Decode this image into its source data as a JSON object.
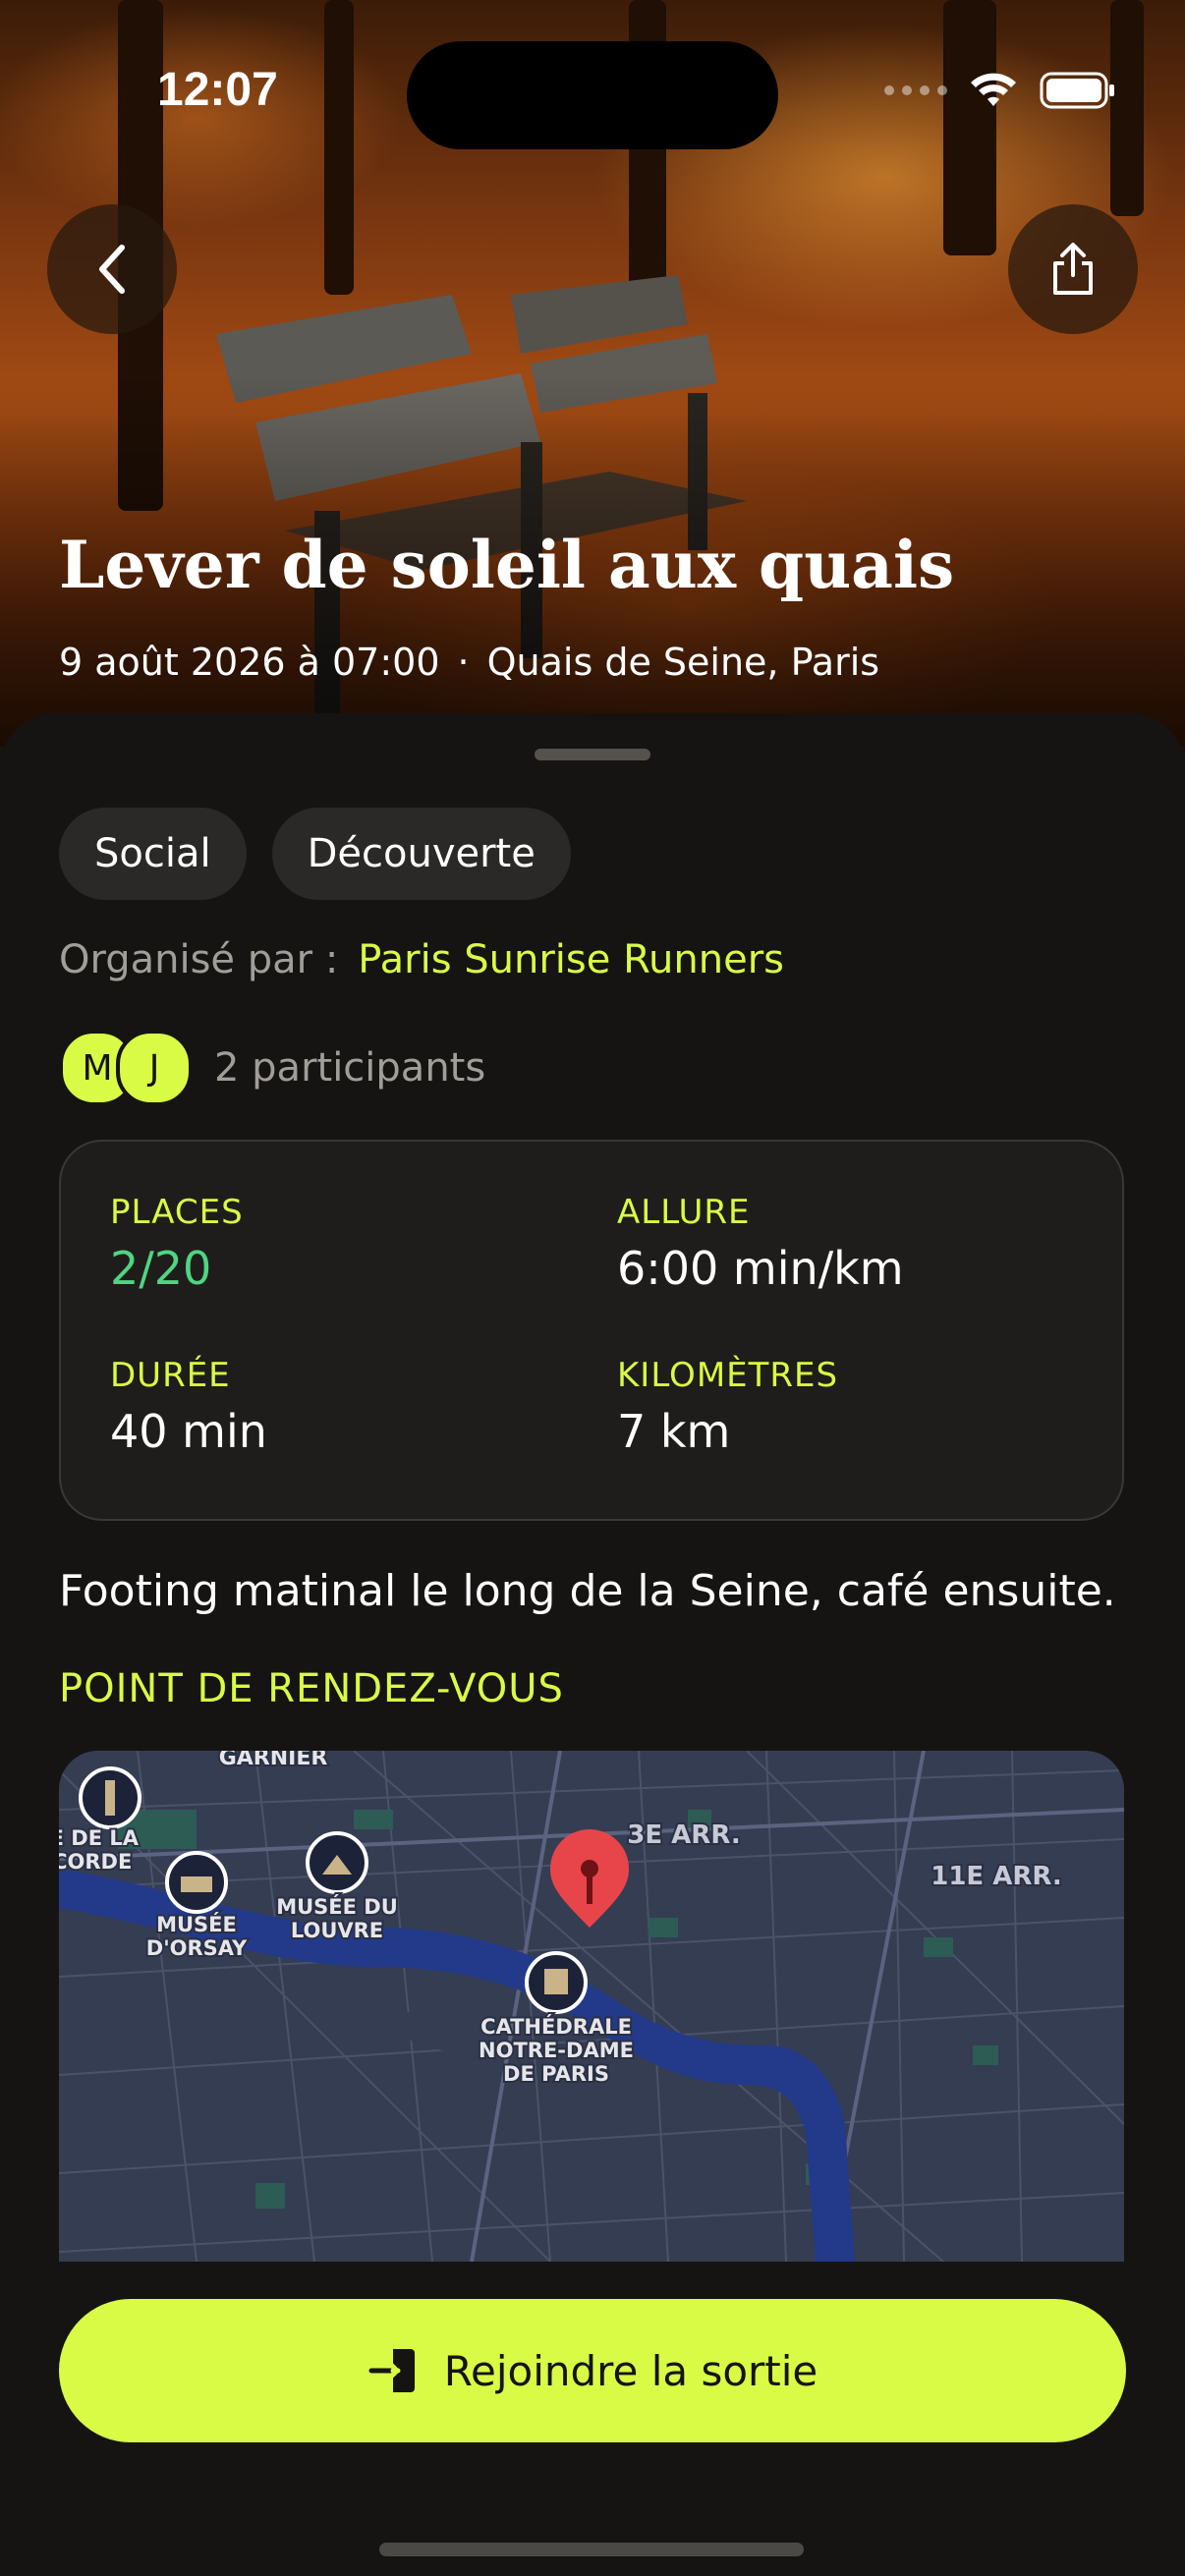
{
  "status_bar": {
    "time": "12:07"
  },
  "hero": {
    "title": "Lever de soleil aux quais",
    "date": "9 août 2026 à 07:00",
    "separator": "·",
    "location": "Quais de Seine, Paris",
    "back_icon": "chevron-left-icon",
    "share_icon": "share-icon"
  },
  "tags": [
    "Social",
    "Découverte"
  ],
  "organizer": {
    "label": "Organisé par :",
    "name": "Paris Sunrise Runners"
  },
  "participants": {
    "initials": [
      "M",
      "J"
    ],
    "count_text": "2 participants"
  },
  "stats": {
    "places": {
      "label": "PLACES",
      "value": "2/20"
    },
    "pace": {
      "label": "ALLURE",
      "value": "6:00 min/km"
    },
    "duration": {
      "label": "DURÉE",
      "value": "40 min"
    },
    "distance": {
      "label": "KILOMÈTRES",
      "value": "7 km"
    }
  },
  "description": "Footing matinal le long de la Seine, café ensuite.",
  "meeting_point": {
    "title": "POINT DE RENDEZ-VOUS",
    "map_labels": {
      "garnier": "GARNIER",
      "concorde_1": "ACE DE LA",
      "concorde_2": "ONCORDE",
      "orsay_1": "MUSÉE",
      "orsay_2": "D'ORSAY",
      "louvre_1": "MUSÉE DU",
      "louvre_2": "LOUVRE",
      "arr3": "3E ARR.",
      "arr11": "11E ARR.",
      "notre_dame_1": "CATHÉDRALE",
      "notre_dame_2": "NOTRE-DAME",
      "notre_dame_3": "DE PARIS"
    }
  },
  "cta": {
    "label": "Rejoindre la sortie",
    "icon": "login-icon"
  },
  "colors": {
    "accent": "#d9fb45",
    "places_green": "#4fd582",
    "background": "#151413"
  }
}
